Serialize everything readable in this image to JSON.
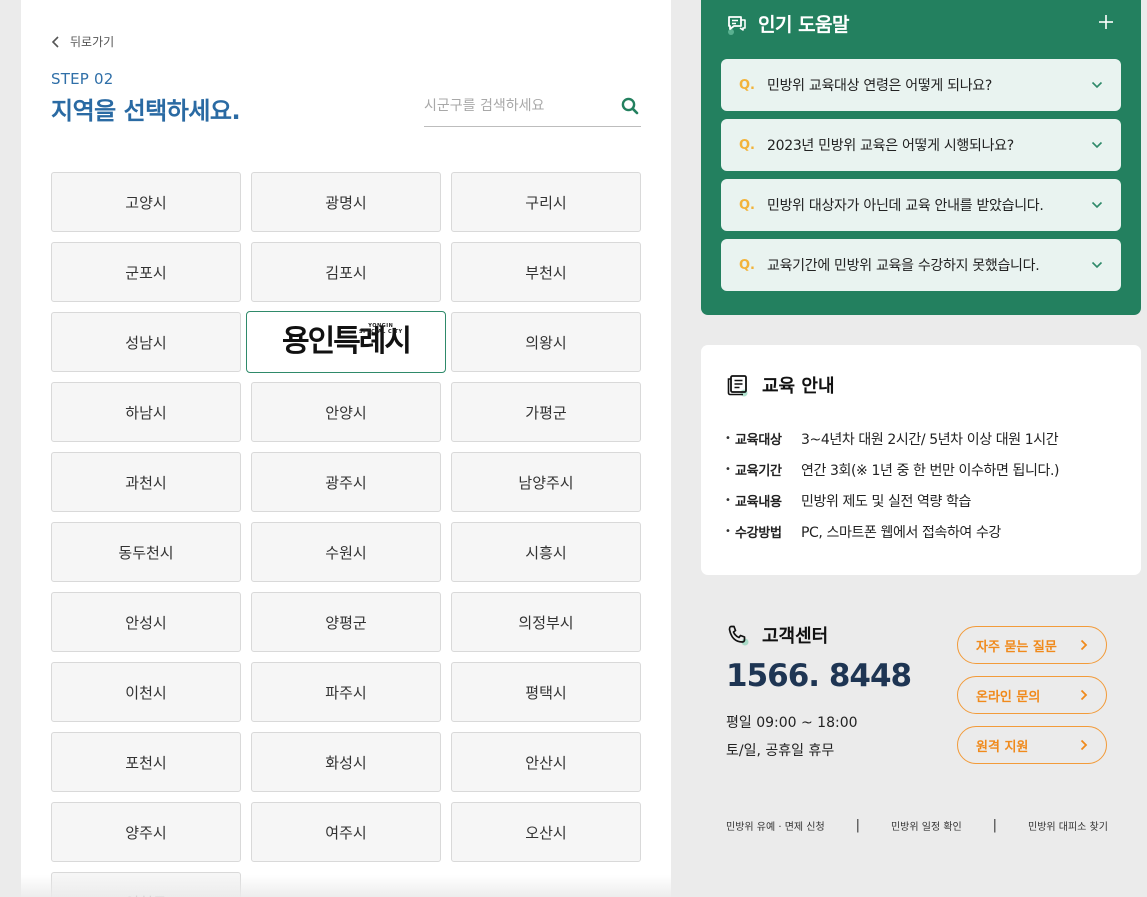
{
  "left": {
    "back_label": "뒤로가기",
    "step": "STEP 02",
    "title": "지역을 선택하세요.",
    "search_placeholder": "시군구를 검색하세요",
    "regions": [
      "고양시",
      "광명시",
      "구리시",
      "군포시",
      "김포시",
      "부천시",
      "성남시",
      "용인특례시",
      "의왕시",
      "하남시",
      "안양시",
      "가평군",
      "과천시",
      "광주시",
      "남양주시",
      "동두천시",
      "수원시",
      "시흥시",
      "안성시",
      "양평군",
      "의정부시",
      "이천시",
      "파주시",
      "평택시",
      "포천시",
      "화성시",
      "안산시",
      "양주시",
      "여주시",
      "오산시",
      "연천군"
    ],
    "logo": {
      "text": "용인특례시",
      "eng_line1": "YONGIN",
      "eng_line2": "SPECIAL CITY"
    }
  },
  "faq": {
    "title": "인기 도움말",
    "q_marker": "Q.",
    "items": [
      "민방위 교육대상 연령은 어떻게 되나요?",
      "2023년 민방위 교육은 어떻게 시행되나요?",
      "민방위 대상자가 아닌데 교육 안내를 받았습니다.",
      "교육기간에 민방위 교육을 수강하지 못했습니다."
    ]
  },
  "edu": {
    "title": "교육 안내",
    "rows": [
      {
        "label": "교육대상",
        "value": "3~4년차 대원 2시간/ 5년차 이상 대원 1시간"
      },
      {
        "label": "교육기간",
        "value": "연간 3회(※ 1년 중 한 번만 이수하면 됩니다.)"
      },
      {
        "label": "교육내용",
        "value": "민방위 제도 및 실전 역량 학습"
      },
      {
        "label": "수강방법",
        "value": "PC, 스마트폰 웹에서 접속하여 수강"
      }
    ]
  },
  "cs": {
    "title": "고객센터",
    "phone": "1566. 8448",
    "hours_weekday": "평일 09:00 ~ 18:00",
    "hours_weekend": "토/일, 공휴일 휴무",
    "buttons": [
      "자주 묻는 질문",
      "온라인 문의",
      "원격 지원"
    ],
    "links": [
      "민방위 유예 · 면제 신청",
      "민방위 일정 확인",
      "민방위 대피소 찾기"
    ],
    "separator": "|"
  },
  "colors": {
    "primary_blue": "#2a6aa3",
    "green": "#23805f",
    "orange": "#f08a1c",
    "q_yellow": "#f2b33a",
    "phone_navy": "#1e3553"
  }
}
